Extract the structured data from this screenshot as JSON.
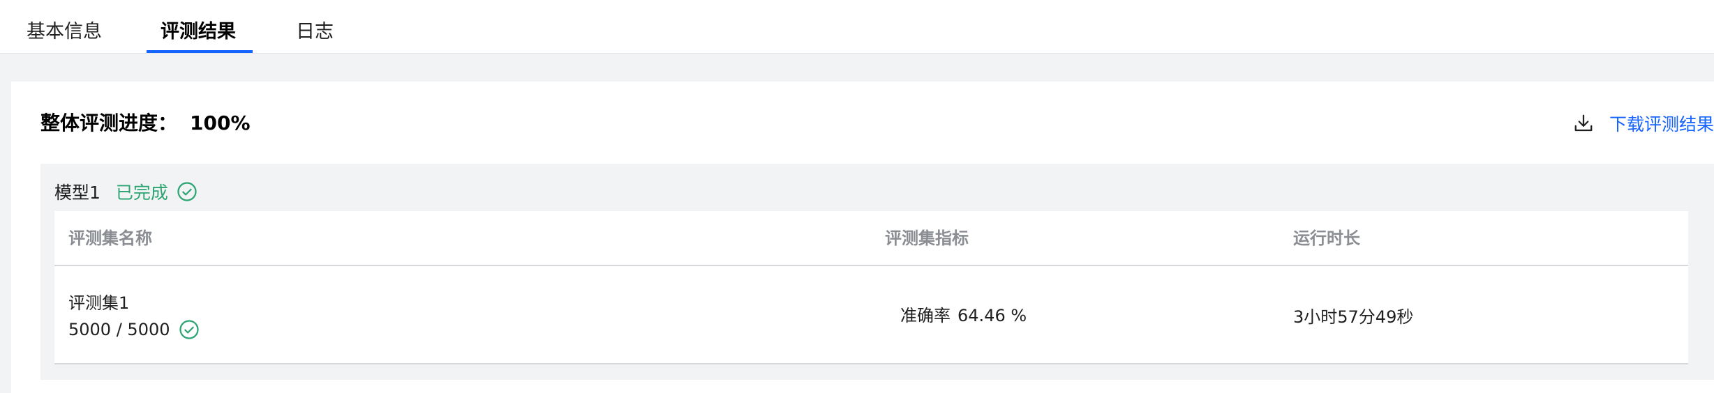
{
  "tabs": [
    {
      "label": "基本信息",
      "active": false
    },
    {
      "label": "评测结果",
      "active": true
    },
    {
      "label": "日志",
      "active": false
    }
  ],
  "summary": {
    "progress_label": "整体评测进度：",
    "progress_value": "100%",
    "download_label": "下载评测结果",
    "download_icon": "download-icon"
  },
  "models": [
    {
      "name": "模型1",
      "status": "已完成",
      "status_icon": "check-circle-icon",
      "table": {
        "columns": [
          "评测集名称",
          "评测集指标",
          "运行时长"
        ],
        "rows": [
          {
            "dataset": "评测集1",
            "count": "5000 / 5000",
            "count_icon": "check-circle-icon",
            "metric_name": "准确率",
            "metric_value": "64.46 %",
            "duration": "3小时57分49秒"
          }
        ]
      }
    }
  ],
  "colors": {
    "accent": "#1664ff",
    "success": "#2ba471",
    "header_text": "#8a8d92",
    "page_bg": "#f2f3f5"
  }
}
